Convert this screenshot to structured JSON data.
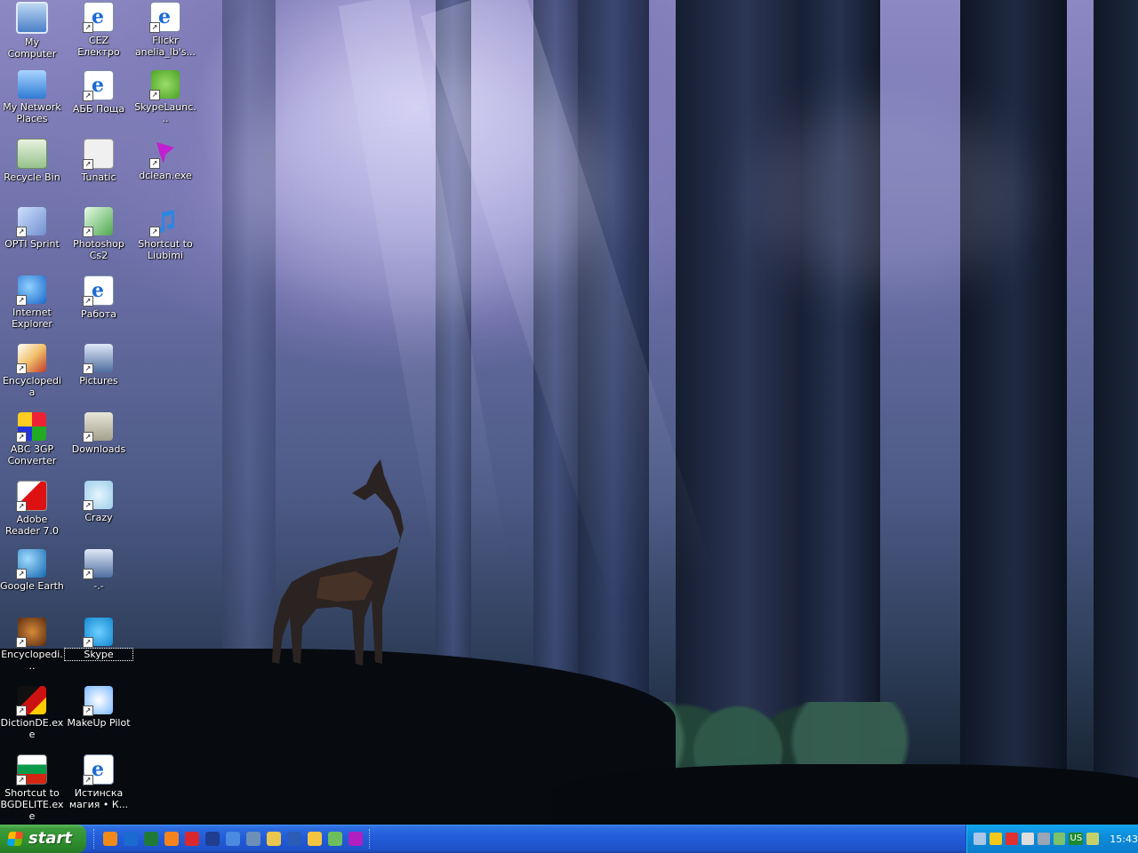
{
  "desktop": {
    "icons": [
      {
        "label": "My Computer",
        "icon": "my-computer-icon"
      },
      {
        "label": "CEZ Електро",
        "icon": "internet-shortcut-icon"
      },
      {
        "label": "Flickr anelia_lb's...",
        "icon": "internet-shortcut-icon"
      },
      {
        "label": "My Network Places",
        "icon": "network-places-icon"
      },
      {
        "label": "АББ Поща",
        "icon": "internet-shortcut-icon"
      },
      {
        "label": "SkypeLaunc...",
        "icon": "skype-green-icon"
      },
      {
        "label": "Recycle Bin",
        "icon": "recycle-bin-icon"
      },
      {
        "label": "Tunatic",
        "icon": "tunatic-icon"
      },
      {
        "label": "dclean.exe",
        "icon": "funnel-icon"
      },
      {
        "label": "OPTI Sprint",
        "icon": "opti-sprint-icon"
      },
      {
        "label": "Photoshop Cs2",
        "icon": "photoshop-feather-icon"
      },
      {
        "label": "Shortcut to Liubimi",
        "icon": "music-note-icon"
      },
      {
        "label": "Internet Explorer",
        "icon": "internet-explorer-icon"
      },
      {
        "label": "Работа",
        "icon": "internet-shortcut-icon"
      },
      {
        "label": "Encyclopedia",
        "icon": "encyclopedia-icon"
      },
      {
        "label": "Pictures",
        "icon": "camera-icon"
      },
      {
        "label": "ABC 3GP Converter",
        "icon": "3gp-converter-icon"
      },
      {
        "label": "Downloads",
        "icon": "folder-icon"
      },
      {
        "label": "Adobe Reader 7.0",
        "icon": "adobe-reader-icon"
      },
      {
        "label": "Crazy",
        "icon": "bear-icon"
      },
      {
        "label": "Google Earth",
        "icon": "google-earth-icon"
      },
      {
        "label": "-.-",
        "icon": "camera-icon"
      },
      {
        "label": "Encyclopedi...",
        "icon": "encyclopedia-brown-icon"
      },
      {
        "label": "Skype",
        "icon": "skype-icon"
      },
      {
        "label": "DictionDE.exe",
        "icon": "diction-icon"
      },
      {
        "label": "MakeUp Pilot",
        "icon": "makeup-pilot-icon"
      },
      {
        "label": "Shortcut to BGDELITE.exe",
        "icon": "bulgarian-flag-icon"
      },
      {
        "label": "Истинска магия • К...",
        "icon": "internet-shortcut-icon"
      }
    ]
  },
  "taskbar": {
    "start_label": "start",
    "quick_launch": [
      {
        "icon": "firefox-icon",
        "color": "#f08a1a"
      },
      {
        "icon": "internet-explorer-icon",
        "color": "#1a6ad2"
      },
      {
        "icon": "excel-icon",
        "color": "#1f7a3a"
      },
      {
        "icon": "firefox-orange-icon",
        "color": "#f5841f"
      },
      {
        "icon": "opera-icon",
        "color": "#d8282e"
      },
      {
        "icon": "uk-flag-icon",
        "color": "#1f3e8f"
      },
      {
        "icon": "document-icon",
        "color": "#4a8ae0"
      },
      {
        "icon": "network-icon",
        "color": "#6c8fb8"
      },
      {
        "icon": "folder-icon",
        "color": "#e9c64e"
      },
      {
        "icon": "word-icon",
        "color": "#2a5cb8"
      },
      {
        "icon": "media-player-icon",
        "color": "#f5c542"
      },
      {
        "icon": "icq-icon",
        "color": "#6cbf5c"
      },
      {
        "icon": "funnel-icon",
        "color": "#b020c0"
      }
    ],
    "tray": {
      "icons": [
        {
          "icon": "network-tray-icon",
          "color": "#a7c6e8"
        },
        {
          "icon": "norton-icon",
          "color": "#f2c81c"
        },
        {
          "icon": "no-entry-icon",
          "color": "#e03030"
        },
        {
          "icon": "volume-icon",
          "color": "#dddddd"
        },
        {
          "icon": "clock-tray-icon",
          "color": "#9aa5b5"
        },
        {
          "icon": "recycle-tray-icon",
          "color": "#7cc26a"
        }
      ],
      "language": "US",
      "extra_icon": {
        "icon": "cube-icon",
        "color": "#c4d06a"
      },
      "time": "15:43"
    }
  }
}
